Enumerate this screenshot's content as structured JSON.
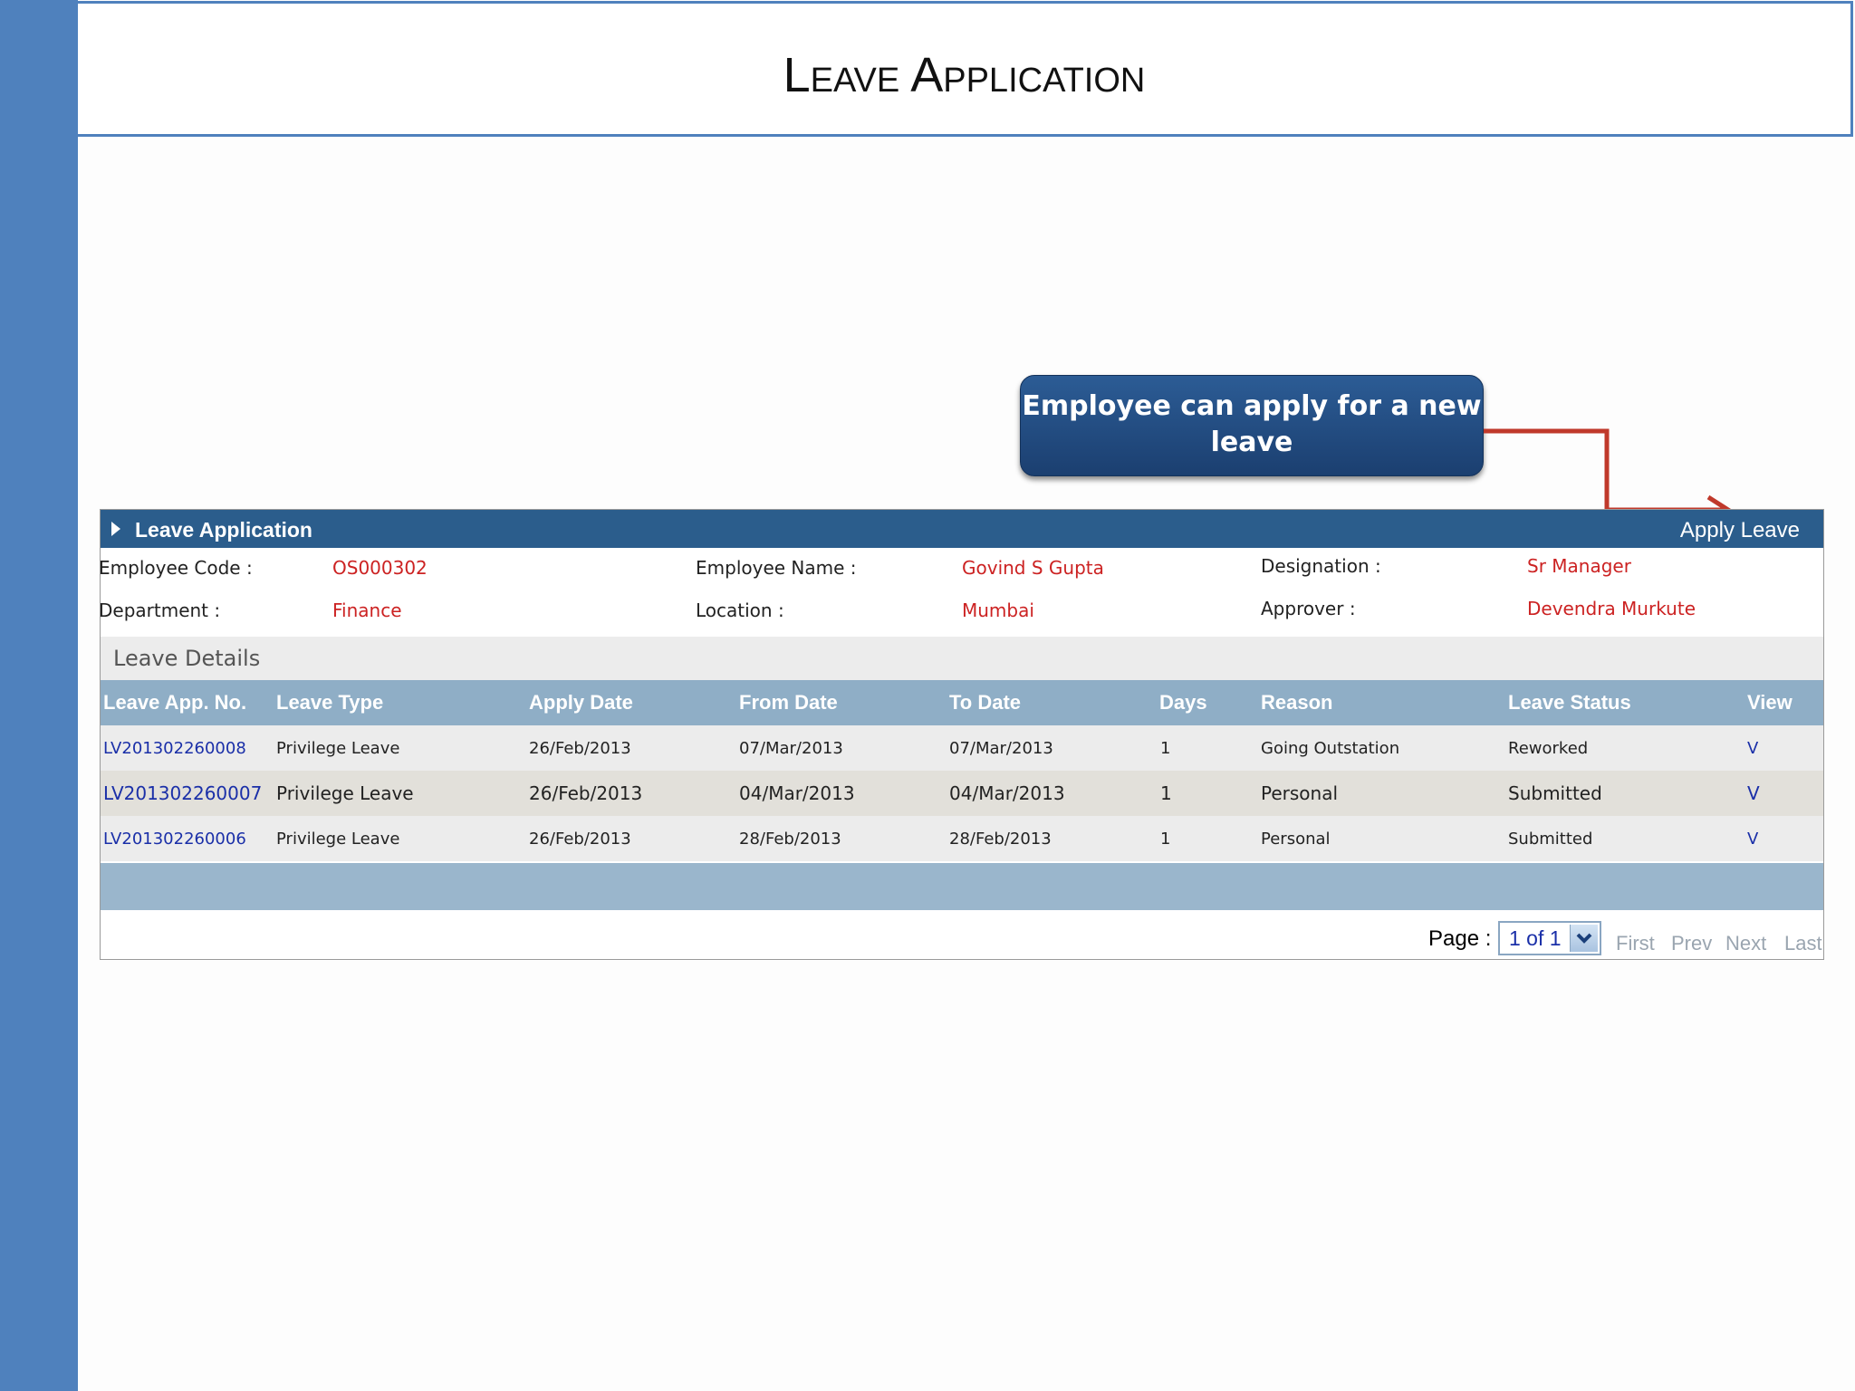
{
  "slide_title": "Leave Application",
  "callout": {
    "text": "Employee can apply for a new leave"
  },
  "panel": {
    "title": "Leave Application",
    "apply_link": "Apply Leave"
  },
  "employee": {
    "code_label": "Employee Code :",
    "code_value": "OS000302",
    "name_label": "Employee Name :",
    "name_value": "Govind S Gupta",
    "designation_label": "Designation :",
    "designation_value": "Sr Manager",
    "department_label": "Department :",
    "department_value": "Finance",
    "location_label": "Location :",
    "location_value": "Mumbai",
    "approver_label": "Approver :",
    "approver_value": "Devendra Murkute"
  },
  "details_heading": "Leave Details",
  "table": {
    "headers": [
      "Leave App. No.",
      "Leave Type",
      "Apply Date",
      "From Date",
      "To Date",
      "Days",
      "Reason",
      "Leave Status",
      "View"
    ],
    "rows": [
      [
        "LV201302260008",
        "Privilege Leave",
        "26/Feb/2013",
        "07/Mar/2013",
        "07/Mar/2013",
        "1",
        "Going Outstation",
        "Reworked",
        "V"
      ],
      [
        "LV201302260007",
        "Privilege Leave",
        "26/Feb/2013",
        "04/Mar/2013",
        "04/Mar/2013",
        "1",
        "Personal",
        "Submitted",
        "V"
      ],
      [
        "LV201302260006",
        "Privilege Leave",
        "26/Feb/2013",
        "28/Feb/2013",
        "28/Feb/2013",
        "1",
        "Personal",
        "Submitted",
        "V"
      ]
    ]
  },
  "pager": {
    "label": "Page :",
    "selected": "1 of 1",
    "first": "First",
    "prev": "Prev",
    "next": "Next",
    "last": "Last"
  },
  "colors": {
    "accent_blue": "#4f81bd",
    "header_blue": "#2b5d8c",
    "value_red": "#cc2222",
    "link_blue": "#1a2fa8",
    "arrow_red": "#c0392b"
  }
}
